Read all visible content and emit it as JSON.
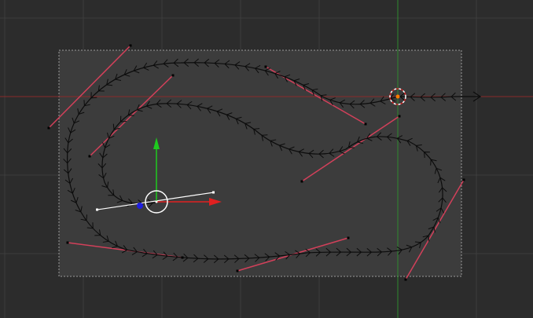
{
  "viewport": {
    "background": "#2c2c2c",
    "grid_color": "#3d3d3d",
    "camera_frame": {
      "fill": "#3c3c3c",
      "border_color": "#9a9a9a"
    },
    "x_axis_color": "#8a2a2a",
    "y_axis_color": "#2e8a2e"
  },
  "curve": {
    "stroke_color": "#0c0c0c",
    "handle_color": "#d2405a",
    "point_color": "#000000",
    "selected_handle_color": "#ffffff"
  },
  "gizmo": {
    "x_arrow_color": "#e02020",
    "y_arrow_color": "#1ecb1e",
    "z_color": "#1e1ee0",
    "ring_color": "#ffffff",
    "cursor_color": "#ff7a00"
  }
}
